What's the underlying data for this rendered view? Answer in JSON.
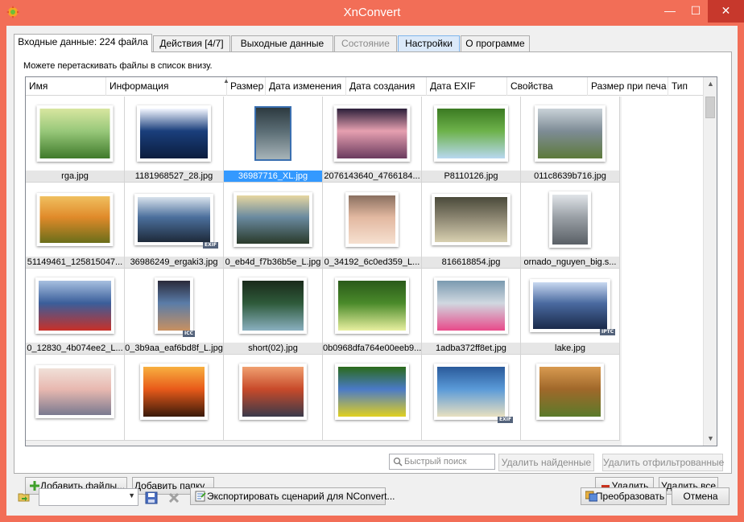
{
  "window": {
    "title": "XnConvert"
  },
  "titlebar": {
    "minimize": "—",
    "maximize": "☐",
    "close": "✕"
  },
  "tabs": [
    {
      "label": "Входные данные: 224 файла",
      "state": "active"
    },
    {
      "label": "Действия [4/7]",
      "state": "normal"
    },
    {
      "label": "Выходные данные",
      "state": "normal"
    },
    {
      "label": "Состояние",
      "state": "disabled"
    },
    {
      "label": "Настройки",
      "state": "highlight"
    },
    {
      "label": "О программе",
      "state": "normal"
    }
  ],
  "input": {
    "hint": "Можете перетаскивать файлы в список внизу.",
    "columns": [
      "Имя",
      "Информация",
      "Размер",
      "Дата изменения",
      "Дата создания",
      "Дата EXIF",
      "Свойства",
      "Размер при печа",
      "Тип"
    ],
    "sort_column": "Размер",
    "files": [
      {
        "name": "rga.jpg",
        "badge": "",
        "selected": false,
        "colors": [
          "#98c87a",
          "#3f7a2a",
          "#d8e6a0"
        ]
      },
      {
        "name": "1181968527_28.jpg",
        "badge": "",
        "selected": false,
        "colors": [
          "#1a3f7c",
          "#0b1d3e",
          "#f3f6ff"
        ]
      },
      {
        "name": "36987716_XL.jpg",
        "badge": "",
        "selected": true,
        "colors": [
          "#5a6c74",
          "#a7b4b8",
          "#2d3a40"
        ]
      },
      {
        "name": "2076143640_4766184...",
        "badge": "",
        "selected": false,
        "colors": [
          "#e6a0b0",
          "#6a3a5e",
          "#2c1f3a"
        ]
      },
      {
        "name": "P8110126.jpg",
        "badge": "",
        "selected": false,
        "colors": [
          "#6db24a",
          "#b8d8f0",
          "#3b7a22"
        ]
      },
      {
        "name": "011c8639b716.jpg",
        "badge": "",
        "selected": false,
        "colors": [
          "#7e8c96",
          "#5d7a3a",
          "#c9d2d8"
        ]
      },
      {
        "name": "51149461_125815047...",
        "badge": "",
        "selected": false,
        "colors": [
          "#e08a2a",
          "#6a6e1a",
          "#f0c060"
        ]
      },
      {
        "name": "36986249_ergaki3.jpg",
        "badge": "EXIF",
        "selected": false,
        "colors": [
          "#4b6f9c",
          "#1e2a3a",
          "#d8e2ec"
        ]
      },
      {
        "name": "0_eb4d_f7b36b5e_L.jpg",
        "badge": "",
        "selected": false,
        "colors": [
          "#6a8aa0",
          "#2a3a2a",
          "#e6d6a0"
        ]
      },
      {
        "name": "0_34192_6c0ed359_L...",
        "badge": "",
        "selected": false,
        "colors": [
          "#e2b8a0",
          "#f6e0d0",
          "#8a7060"
        ]
      },
      {
        "name": "816618854.jpg",
        "badge": "",
        "selected": false,
        "colors": [
          "#8a8470",
          "#d8d0b0",
          "#4a4a3a"
        ]
      },
      {
        "name": "ornado_nguyen_big.s...",
        "badge": "",
        "selected": false,
        "colors": [
          "#9aa0a6",
          "#5a6066",
          "#e0e4e8"
        ]
      },
      {
        "name": "0_12830_4b074ee2_L...",
        "badge": "",
        "selected": false,
        "colors": [
          "#3a5e9a",
          "#c83028",
          "#a8c0e0"
        ]
      },
      {
        "name": "0_3b9aa_eaf6bd8f_L.jpg",
        "badge": "ICC",
        "selected": false,
        "colors": [
          "#5a7ca8",
          "#c89060",
          "#2a2a3a"
        ]
      },
      {
        "name": "short(02).jpg",
        "badge": "",
        "selected": false,
        "colors": [
          "#2e5a3a",
          "#8ab0c0",
          "#1a2a1a"
        ]
      },
      {
        "name": "0b0968dfa764e00eeb9...",
        "badge": "",
        "selected": false,
        "colors": [
          "#4a8a2a",
          "#e8f0a0",
          "#2a5a1a"
        ]
      },
      {
        "name": "1adba372ff8et.jpg",
        "badge": "",
        "selected": false,
        "colors": [
          "#d0d8e0",
          "#e84a8a",
          "#7a9ab0"
        ]
      },
      {
        "name": "lake.jpg",
        "badge": "IPTC",
        "selected": false,
        "colors": [
          "#4a6aa0",
          "#1a2a4a",
          "#c8d8f0"
        ]
      },
      {
        "name": "",
        "badge": "",
        "selected": false,
        "colors": [
          "#e8b8b0",
          "#7a7a90",
          "#f0e0d8"
        ]
      },
      {
        "name": "",
        "badge": "",
        "selected": false,
        "colors": [
          "#e85a1a",
          "#3a1a0a",
          "#f8b040"
        ]
      },
      {
        "name": "",
        "badge": "",
        "selected": false,
        "colors": [
          "#c84a2a",
          "#3a3a4a",
          "#f0a070"
        ]
      },
      {
        "name": "",
        "badge": "",
        "selected": false,
        "colors": [
          "#4a7ac8",
          "#e0d020",
          "#2a6a1a"
        ]
      },
      {
        "name": "",
        "badge": "EXIF",
        "selected": false,
        "colors": [
          "#5a9ad8",
          "#e8e0c0",
          "#2a5a9a"
        ]
      },
      {
        "name": "",
        "badge": "",
        "selected": false,
        "colors": [
          "#a0682a",
          "#5a7a2a",
          "#d89a50"
        ]
      }
    ]
  },
  "search": {
    "placeholder": "Быстрый поиск"
  },
  "buttons": {
    "delete_found": "Удалить найденные",
    "delete_filtered": "Удалить отфильтрованные",
    "add_files": "Добавить файлы...",
    "add_folder": "Добавить папку...",
    "delete": "Удалить",
    "delete_all": "Удалить все",
    "export_script": "Экспортировать сценарий для NConvert...",
    "convert": "Преобразовать",
    "cancel": "Отмена"
  },
  "preset_combo": {
    "value": ""
  },
  "colors": {
    "titlebar": "#f26e57",
    "close": "#c7382c",
    "selection": "#3399ff"
  }
}
